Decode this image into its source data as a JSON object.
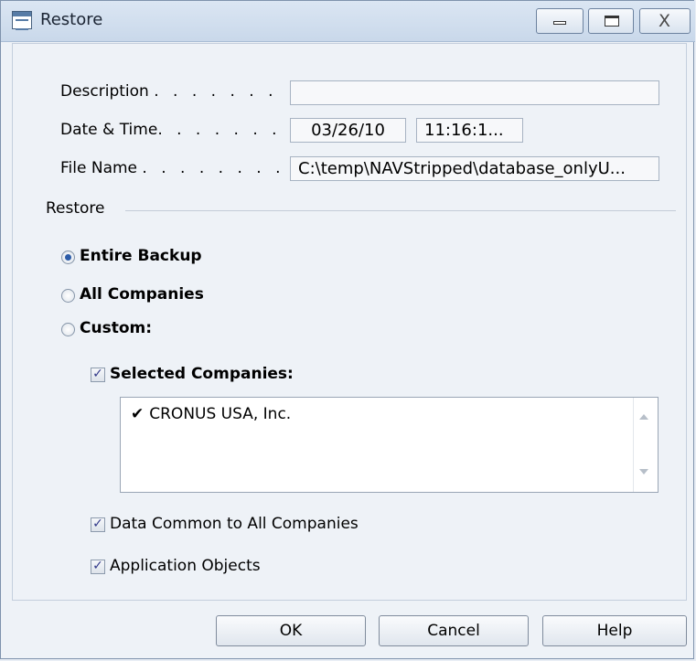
{
  "window": {
    "title": "Restore",
    "icon": "form-icon",
    "close_glyph": "X"
  },
  "fields": {
    "description": {
      "label": "Description",
      "dots": ". . . . . . .",
      "value": ""
    },
    "datetime": {
      "label": "Date & Time",
      "dots": ". . . . . . .",
      "date": "03/26/10",
      "time": "11:16:1..."
    },
    "filename": {
      "label": "File Name",
      "dots": ". . . . . . . .",
      "value": "C:\\temp\\NAVStripped\\database_onlyU..."
    }
  },
  "restore": {
    "section_label": "Restore",
    "options": [
      {
        "label": "Entire Backup",
        "selected": true
      },
      {
        "label": "All Companies",
        "selected": false
      },
      {
        "label": "Custom:",
        "selected": false
      }
    ],
    "selected_companies": {
      "label": "Selected Companies:",
      "checked": true
    },
    "companies_list": [
      {
        "check": "✔",
        "name": "CRONUS USA, Inc."
      }
    ],
    "data_common": {
      "label": "Data Common to All Companies",
      "checked": true
    },
    "app_objects": {
      "label": "Application Objects",
      "checked": true
    },
    "check_glyph": "✓"
  },
  "buttons": {
    "ok": "OK",
    "cancel": "Cancel",
    "help": "Help"
  }
}
